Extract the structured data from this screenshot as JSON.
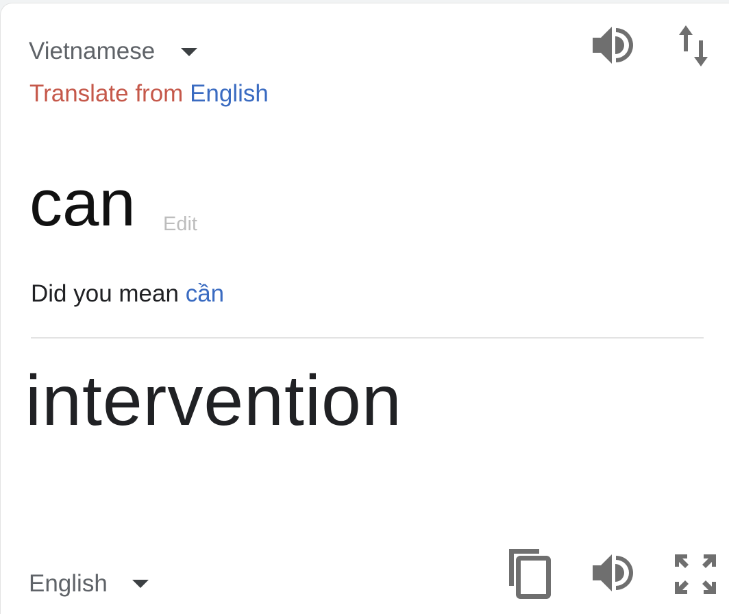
{
  "source": {
    "language": "Vietnamese",
    "translate_from_prefix": "Translate from",
    "translate_from_language": "English",
    "text": "can",
    "edit_label": "Edit",
    "did_you_mean_prefix": "Did you mean",
    "did_you_mean_suggestion": "cần"
  },
  "target": {
    "language": "English",
    "text": "intervention"
  },
  "icons": {
    "speaker_top": "speaker-icon",
    "swap": "swap-languages-icon",
    "copy": "copy-icon",
    "speaker_bottom": "speaker-icon",
    "expand": "fullscreen-icon"
  },
  "colors": {
    "translate_from_prefix": "#c5584a",
    "link_blue": "#3a6bc1",
    "icon_gray": "#6f6f6f"
  }
}
